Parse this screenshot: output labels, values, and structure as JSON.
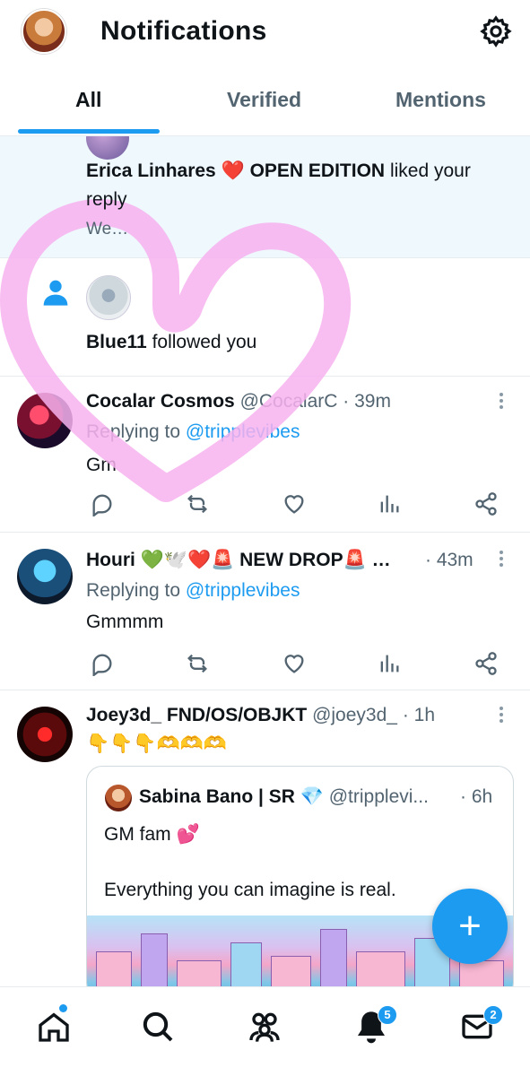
{
  "header": {
    "title": "Notifications",
    "tabs": [
      {
        "label": "All",
        "active": true
      },
      {
        "label": "Verified",
        "active": false
      },
      {
        "label": "Mentions",
        "active": false
      }
    ]
  },
  "notifications": {
    "liked": {
      "name": "Erica Linhares",
      "heart_emoji": "❤️",
      "suffix_bold": "OPEN EDITION",
      "action_a": "liked your",
      "action_b": "reply",
      "snippet": "We…"
    },
    "follow": {
      "name": "Blue11",
      "action": "followed you"
    }
  },
  "tweets": [
    {
      "name": "Cocalar Cosmos",
      "handle": "@CocalarC",
      "time": "· 39m",
      "replying_prefix": "Replying to",
      "replying_handle": "@tripplevibes",
      "text": "Gm"
    },
    {
      "name": "Houri 💚🕊️❤️🚨 NEW DROP🚨 …",
      "handle": "",
      "time": "· 43m",
      "replying_prefix": "Replying to",
      "replying_handle": "@tripplevibes",
      "text": "Gmmmm"
    },
    {
      "name": "Joey3d_ FND/OS/OBJKT",
      "handle": "@joey3d_",
      "time": "· 1h",
      "text": "👇👇👇🫶🫶🫶"
    }
  ],
  "quote": {
    "name": "Sabina Bano | SR 💎",
    "handle": "@tripplevi...",
    "time": "· 6h",
    "line1": "GM fam 💕",
    "line2": "Everything you can imagine is real."
  },
  "fab": {
    "label": "+"
  },
  "bottom_nav": {
    "items": [
      "home",
      "search",
      "communities",
      "notifications",
      "messages"
    ],
    "notifications_badge": "5",
    "messages_badge": "2"
  },
  "colors": {
    "accent": "#1d9bf0",
    "overlay_heart": "#f6b6f0"
  }
}
